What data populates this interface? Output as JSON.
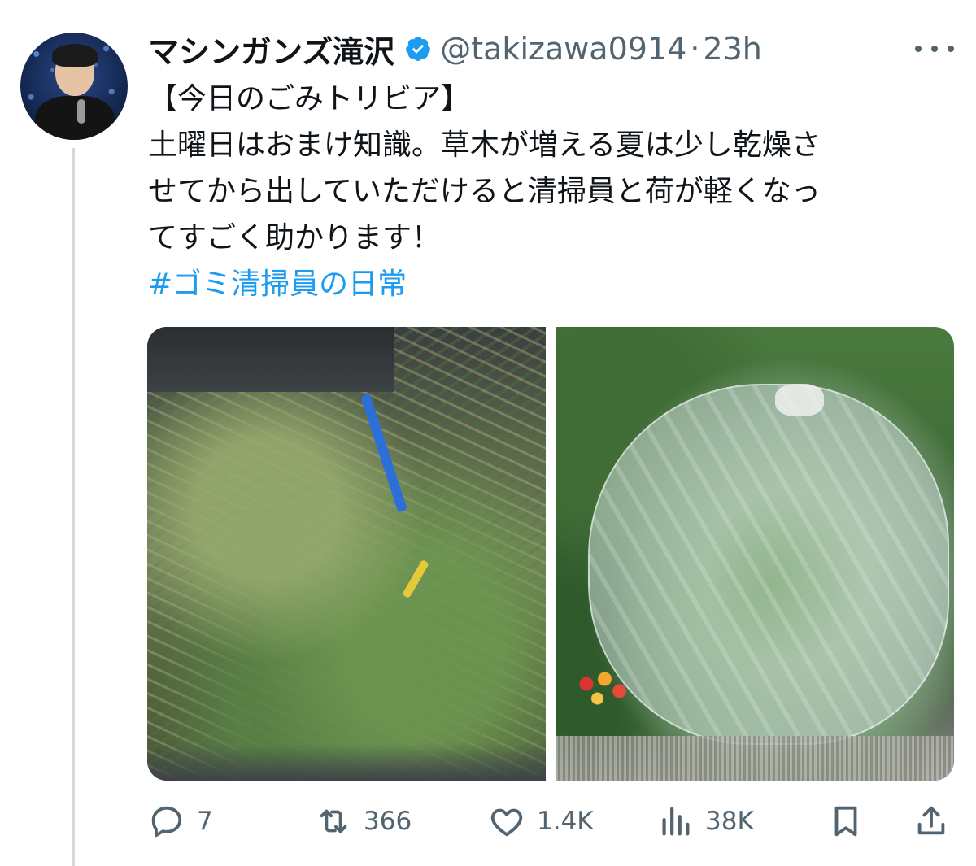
{
  "tweet": {
    "display_name": "マシンガンズ滝沢",
    "handle": "@takizawa0914",
    "separator": "·",
    "time": "23h",
    "text_lines": [
      "【今日のごみトリビア】",
      "土曜日はおまけ知識。草木が増える夏は少し乾燥さ",
      "せてから出していただけると清掃員と荷が軽くなっ",
      "てすごく助かります！"
    ],
    "hashtag": "#ゴミ清掃員の日常"
  },
  "actions": {
    "replies": "7",
    "retweets": "366",
    "likes": "1.4K",
    "views": "38K"
  },
  "icons": {
    "verified": "verified-badge-icon",
    "more": "more-options-icon",
    "reply": "reply-icon",
    "retweet": "retweet-icon",
    "like": "heart-icon",
    "views": "views-chart-icon",
    "bookmark": "bookmark-icon",
    "share": "share-icon"
  },
  "colors": {
    "link": "#1d9bf0",
    "secondary_text": "#536471",
    "primary_text": "#0f1419",
    "verified": "#1d9bf0"
  }
}
